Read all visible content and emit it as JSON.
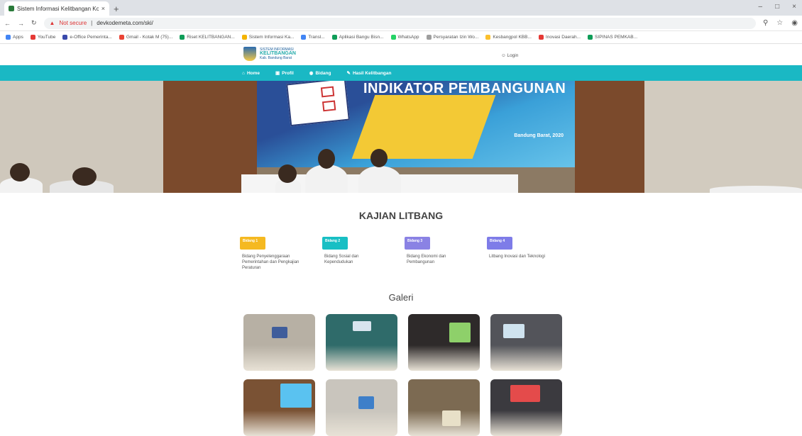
{
  "browser": {
    "tab_title": "Sistem Informasi Kelitbangan Ko",
    "tab_close": "×",
    "new_tab": "+",
    "window_controls": [
      "–",
      "□",
      "×"
    ],
    "not_secure": "Not secure",
    "url": "devkodemeta.com/ski/",
    "bookmarks": [
      {
        "label": "Apps",
        "color": "#4285f4"
      },
      {
        "label": "YouTube",
        "color": "#e53935"
      },
      {
        "label": "e-Office Pemerinta...",
        "color": "#3949ab"
      },
      {
        "label": "Gmail - Kotak M (75)...",
        "color": "#ea4335"
      },
      {
        "label": "Riset KELITBANGAN...",
        "color": "#0f9d58"
      },
      {
        "label": "Sistem Informasi Ka...",
        "color": "#f4b400"
      },
      {
        "label": "Transl...",
        "color": "#4285f4"
      },
      {
        "label": "Aplikasi Bangu Bisn...",
        "color": "#0f9d58"
      },
      {
        "label": "WhatsApp",
        "color": "#25d366"
      },
      {
        "label": "Persyaratan Izin Wo...",
        "color": "#9e9e9e"
      },
      {
        "label": "Kesbangpol KBB...",
        "color": "#fbc02d"
      },
      {
        "label": "Inovasi Daerah...",
        "color": "#e53935"
      },
      {
        "label": "SIPINAS PEMKAB...",
        "color": "#0f9d58"
      }
    ]
  },
  "site": {
    "logo_line1": "SISTEM INFORMASI",
    "logo_line2": "KELITBANGAN",
    "logo_line3": "Kab. Bandung Barat",
    "login": "Login",
    "nav": [
      {
        "icon": "⌂",
        "label": "Home"
      },
      {
        "icon": "▣",
        "label": "Profil"
      },
      {
        "icon": "◉",
        "label": "Bidang"
      },
      {
        "icon": "✎",
        "label": "Hasil Kelitbangan"
      }
    ]
  },
  "hero": {
    "title": "INDIKATOR PEMBANGUNAN",
    "city": "Bandung Barat, 2020"
  },
  "kajian": {
    "title": "KAJIAN LITBANG",
    "items": [
      {
        "badge": "Bidang 1",
        "color": "#f5b921",
        "desc": "Bidang Penyelenggaraan Pemerintahan dan Pengkajian Peraturan"
      },
      {
        "badge": "Bidang 2",
        "color": "#18bfc4",
        "desc": "Bidang Sosial dan Kependudukan"
      },
      {
        "badge": "Bidang 3",
        "color": "#8a82e4",
        "desc": "Bidang Ekonomi dan Pembangunan"
      },
      {
        "badge": "Bidang 4",
        "color": "#7e7ce8",
        "desc": "Litbang Inovasi dan Teknologi"
      }
    ]
  },
  "galeri": {
    "title": "Galeri",
    "photos": [
      {
        "label": "seminar-room",
        "bg": "#b7b0a4",
        "screen": "#3f5d9b"
      },
      {
        "label": "group-stage",
        "bg": "#2f6b6a",
        "screen": "#d8e4ee"
      },
      {
        "label": "dark-room-presentation",
        "bg": "#2e2a2a",
        "screen": "#8ed06a"
      },
      {
        "label": "meeting-table",
        "bg": "#53545a",
        "screen": "#cfe3ef"
      },
      {
        "label": "audience-projector",
        "bg": "#7a5234",
        "screen": "#5ac2f0"
      },
      {
        "label": "seminar-hall",
        "bg": "#c9c5bd",
        "screen": "#3e7fc9"
      },
      {
        "label": "award-ceremony",
        "bg": "#7c6a52",
        "screen": "#e8e0c8"
      },
      {
        "label": "audience-stage",
        "bg": "#3b3a3f",
        "screen": "#e44b4b"
      }
    ]
  }
}
